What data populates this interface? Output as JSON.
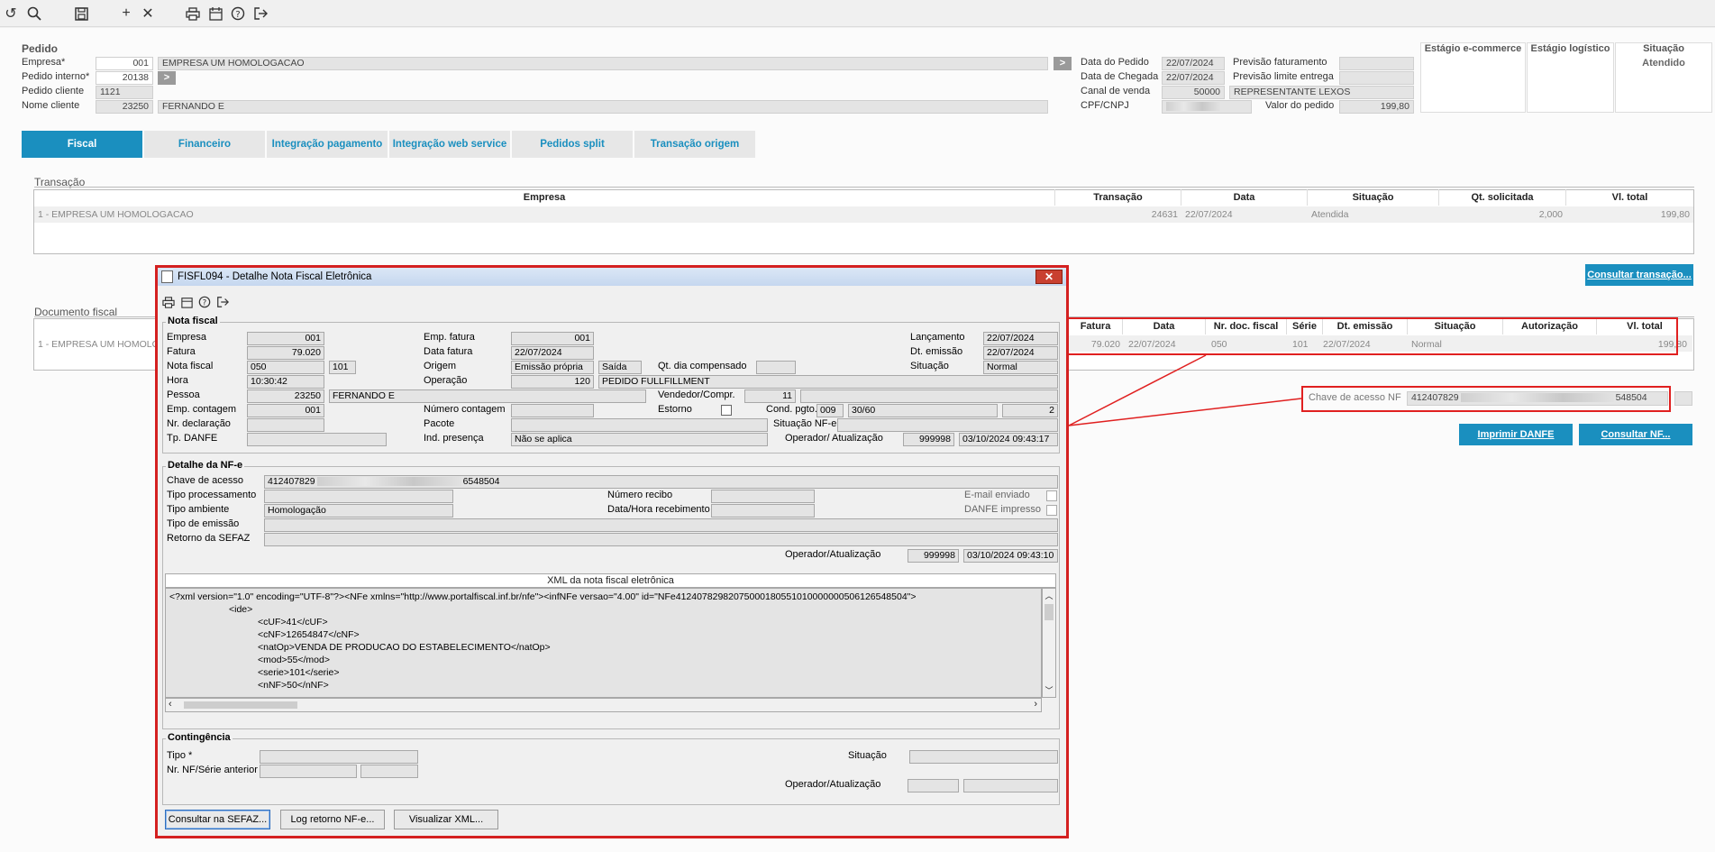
{
  "toolbar": {
    "icons": [
      "undo-icon",
      "search-icon",
      "save-icon",
      "add-icon",
      "close-icon",
      "print-icon",
      "calendar-icon",
      "help-icon",
      "exit-icon"
    ]
  },
  "pedido": {
    "title": "Pedido",
    "empresa_label": "Empresa*",
    "empresa_code": "001",
    "empresa_name": "EMPRESA UM HOMOLOGACAO",
    "pedido_interno_label": "Pedido interno*",
    "pedido_interno": "20138",
    "pedido_cliente_label": "Pedido cliente",
    "pedido_cliente": "1121",
    "nome_cliente_label": "Nome cliente",
    "cliente_code": "23250",
    "cliente_name": "FERNANDO E",
    "data_pedido_label": "Data do Pedido",
    "data_pedido": "22/07/2024",
    "data_chegada_label": "Data de Chegada",
    "data_chegada": "22/07/2024",
    "canal_label": "Canal de venda",
    "canal_code": "50000",
    "canal_name": "REPRESENTANTE LEXOS",
    "cpf_label": "CPF/CNPJ",
    "valor_label": "Valor do pedido",
    "valor": "199,80",
    "prev_fat_label": "Previsão faturamento",
    "prev_lim_label": "Previsão limite entrega",
    "estagio_ecom": "Estágio e-commerce",
    "estagio_log": "Estágio logístico",
    "situacao_label": "Situação",
    "situacao_value": "Atendido"
  },
  "tabs": [
    "Fiscal",
    "Financeiro",
    "Integração pagamento",
    "Integração web service",
    "Pedidos split",
    "Transação origem"
  ],
  "transacao": {
    "title": "Transação",
    "headers": [
      "Empresa",
      "Transação",
      "Data",
      "Situação",
      "Qt. solicitada",
      "Vl. total"
    ],
    "row": [
      "1 - EMPRESA UM HOMOLOGACAO",
      "24631",
      "22/07/2024",
      "Atendida",
      "2,000",
      "199,80"
    ],
    "button": "Consultar transação..."
  },
  "documento": {
    "title": "Documento fiscal",
    "row_empresa": "1 - EMPRESA UM HOMOLOGAC",
    "headers": [
      "Fatura",
      "Data",
      "Nr. doc. fiscal",
      "Série",
      "Dt. emissão",
      "Situação",
      "Autorização",
      "Vl. total"
    ],
    "row": [
      "79.020",
      "22/07/2024",
      "050",
      "101",
      "22/07/2024",
      "Normal",
      "",
      "199,80"
    ],
    "chave_label": "Chave de acesso NF",
    "chave_start": "412407829",
    "chave_end": "548504",
    "btn_danfe": "Imprimir DANFE",
    "btn_nf": "Consultar NF..."
  },
  "dialog": {
    "title": "FISFL094 - Detalhe Nota Fiscal Eletrônica",
    "close": "✕",
    "nf_group": "Nota fiscal",
    "empresa_label": "Empresa",
    "empresa": "001",
    "fatura_label": "Fatura",
    "fatura": "79.020",
    "nota_label": "Nota fiscal",
    "nota": "050",
    "serie": "101",
    "hora_label": "Hora",
    "hora": "10:30:42",
    "pessoa_label": "Pessoa",
    "pessoa_code": "23250",
    "pessoa_name": "FERNANDO E",
    "emp_contagem_label": "Emp. contagem",
    "emp_contagem": "001",
    "nr_decl_label": "Nr. declaração",
    "tp_danfe_label": "Tp. DANFE",
    "emp_fatura_label": "Emp. fatura",
    "emp_fatura": "001",
    "data_fatura_label": "Data fatura",
    "data_fatura": "22/07/2024",
    "origem_label": "Origem",
    "origem": "Emissão própria",
    "saida": "Saída",
    "qt_dia_label": "Qt. dia compensado",
    "operacao_label": "Operação",
    "operacao_code": "120",
    "operacao_name": "PEDIDO FULLFILLMENT",
    "vendedor_label": "Vendedor/Compr.",
    "vendedor": "11",
    "num_contagem_label": "Número contagem",
    "estorno_label": "Estorno",
    "cond_label": "Cond. pgto.",
    "cond_code": "009",
    "cond_name": "30/60",
    "cond_extra": "2",
    "pacote_label": "Pacote",
    "ind_presenca_label": "Ind. presença",
    "ind_presenca": "Não se aplica",
    "lancamento_label": "Lançamento",
    "lancamento": "22/07/2024",
    "dt_emissao_label": "Dt. emissão",
    "dt_emissao": "22/07/2024",
    "situacao_label": "Situação",
    "situacao": "Normal",
    "situacao_nfe_label": "Situação NF-e",
    "operador_label": "Operador/ Atualização",
    "operador": "999998",
    "atualizacao": "03/10/2024 09:43:17",
    "nfe_group": "Detalhe da NF-e",
    "chave_label": "Chave de acesso",
    "chave_start": "412407829",
    "chave_end": "6548504",
    "tipo_proc_label": "Tipo processamento",
    "tipo_amb_label": "Tipo ambiente",
    "tipo_amb": "Homologação",
    "tipo_emissao_label": "Tipo de emissão",
    "retorno_label": "Retorno da SEFAZ",
    "num_recibo_label": "Número recibo",
    "data_receb_label": "Data/Hora recebimento",
    "email_label": "E-mail enviado",
    "danfe_imp_label": "DANFE impresso",
    "operador2_label": "Operador/Atualização",
    "operador2": "999998",
    "atualizacao2": "03/10/2024 09:43:10",
    "xml_title": "XML da nota fiscal eletrônica",
    "xml_lines": [
      "<?xml version=\"1.0\" encoding=\"UTF-8\"?><NFe xmlns=\"http://www.portalfiscal.inf.br/nfe\"><infNFe versao=\"4.00\" id=\"NFe41240782982075000180551010000000506126548504\">",
      "<ide>",
      "<cUF>41</cUF>",
      "<cNF>12654847</cNF>",
      "<natOp>VENDA DE PRODUCAO DO ESTABELECIMENTO</natOp>",
      "<mod>55</mod>",
      "<serie>101</serie>",
      "<nNF>50</nNF>"
    ],
    "cont_group": "Contingência",
    "tipo_label": "Tipo *",
    "nr_nf_label": "Nr. NF/Série anterior",
    "cont_situacao_label": "Situação",
    "cont_operador_label": "Operador/Atualização",
    "btn_sefaz": "Consultar na SEFAZ...",
    "btn_log": "Log retorno NF-e...",
    "btn_xml": "Visualizar XML..."
  }
}
